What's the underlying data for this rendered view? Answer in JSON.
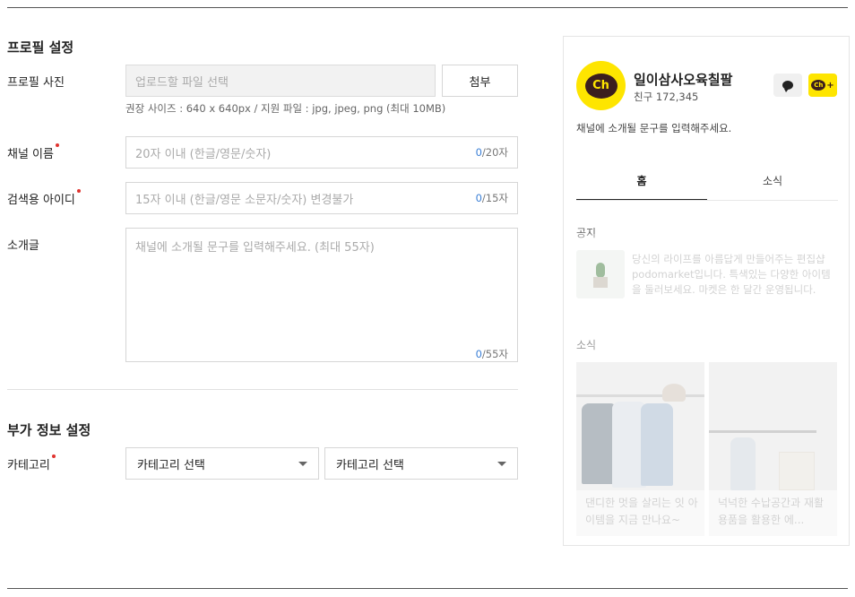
{
  "profile_section": {
    "title": "프로필 설정",
    "photo_label": "프로필 사진",
    "file_placeholder": "업로드할 파일 선택",
    "attach_button": "첨부",
    "file_hint": "권장 사이즈 : 640 x 640px / 지원 파일 : jpg, jpeg, png (최대 10MB)",
    "channel_name_label": "채널 이름",
    "channel_name_placeholder": "20자 이내 (한글/영문/숫자)",
    "channel_name_count": "0",
    "channel_name_max": "/20자",
    "search_id_label": "검색용 아이디",
    "search_id_placeholder": "15자 이내 (한글/영문 소문자/숫자) 변경불가",
    "search_id_count": "0",
    "search_id_max": "/15자",
    "intro_label": "소개글",
    "intro_placeholder": "채널에 소개될 문구를 입력해주세요. (최대 55자)",
    "intro_count": "0",
    "intro_max": "/55자"
  },
  "extra_section": {
    "title": "부가 정보 설정",
    "category_label": "카테고리",
    "category_select_1": "카테고리 선택",
    "category_select_2": "카테고리 선택"
  },
  "preview": {
    "logo_text": "Ch",
    "channel_name": "일이삼사오육칠팔",
    "friends": "친구 172,345",
    "description": "채널에 소개될 문구를 입력해주세요.",
    "chat_icon": "chat-bubble-icon",
    "add_icon": "channel-add-icon",
    "mini_logo_text": "Ch",
    "tabs": [
      {
        "label": "홈"
      },
      {
        "label": "소식"
      }
    ],
    "notice_label": "공지",
    "notice_text": "당신의 라이프를 아름답게 만들어주는 편집샵 podomarket입니다. 특색있는 다양한 아이템을 둘러보세요. 마켓은 한 달간 운영됩니다.",
    "news_label": "소식",
    "news": [
      {
        "caption": "댄디한 멋을 살리는 잇 아이템을 지금 만나요~"
      },
      {
        "caption": "넉넉한 수납공간과 재활용품을 활용한 에..."
      }
    ]
  },
  "colors": {
    "brand_yellow": "#fee500",
    "required_dot": "#e0332f",
    "counter_accent": "#3a7fd6"
  }
}
